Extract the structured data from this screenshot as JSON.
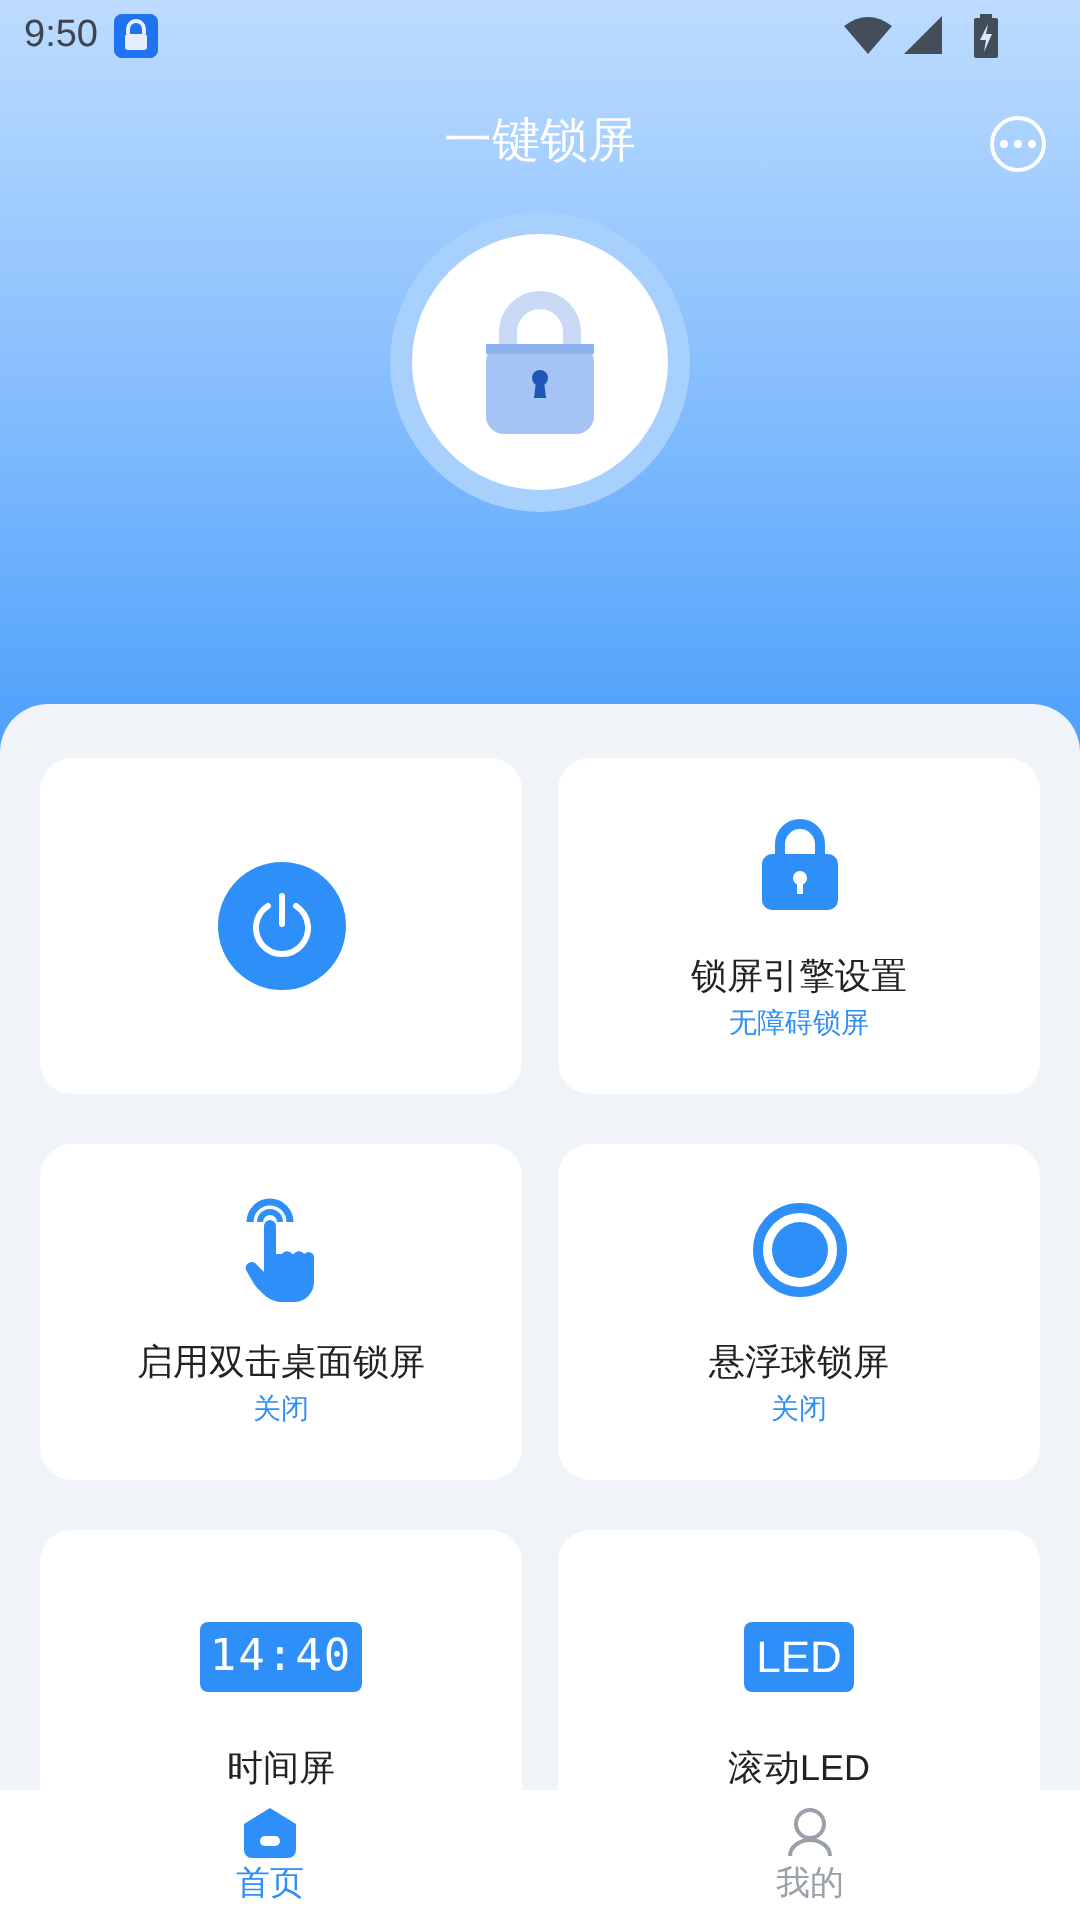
{
  "status_bar": {
    "time": "9:50"
  },
  "title": "一键锁屏",
  "cards": [
    {
      "kind": "power"
    },
    {
      "kind": "lock",
      "title": "锁屏引擎设置",
      "subtitle": "无障碍锁屏"
    },
    {
      "kind": "tap",
      "title": "启用双击桌面锁屏",
      "subtitle": "关闭"
    },
    {
      "kind": "float",
      "title": "悬浮球锁屏",
      "subtitle": "关闭"
    },
    {
      "kind": "clock",
      "icon_text": "14:40",
      "title": "时间屏"
    },
    {
      "kind": "led",
      "icon_text": "LED",
      "title": "滚动LED"
    }
  ],
  "tabs": [
    {
      "kind": "home",
      "label": "首页",
      "selected": true
    },
    {
      "kind": "me",
      "label": "我的",
      "selected": false
    }
  ]
}
